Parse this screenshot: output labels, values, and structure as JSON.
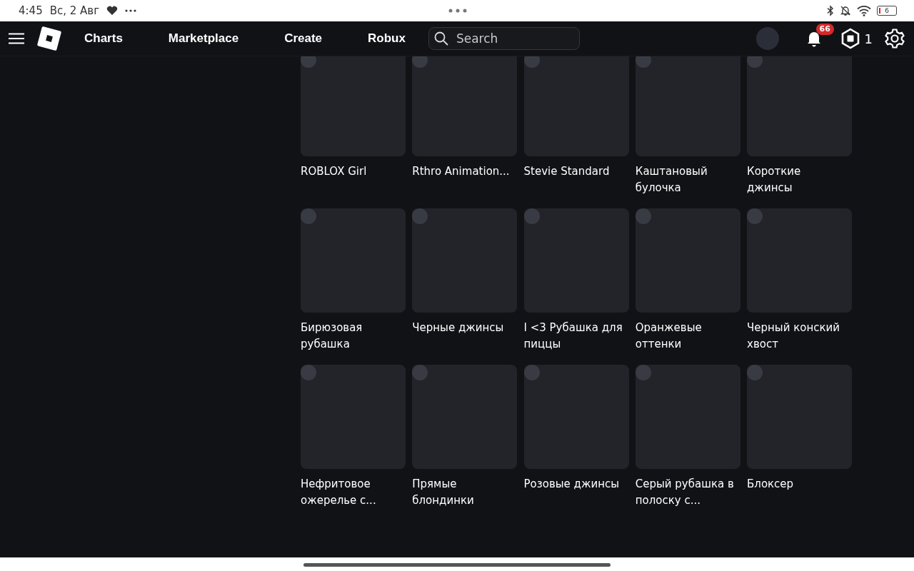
{
  "status_bar": {
    "time": "4:45",
    "date": "Вс, 2 Авг",
    "battery": "6"
  },
  "nav": {
    "links": [
      {
        "label": "Charts"
      },
      {
        "label": "Marketplace"
      },
      {
        "label": "Create"
      },
      {
        "label": "Robux"
      }
    ],
    "search": {
      "placeholder": "Search"
    },
    "notifications": "66",
    "robux": "1"
  },
  "items": [
    {
      "title": "ROBLOX Girl"
    },
    {
      "title": "Rthro Animation..."
    },
    {
      "title": "Stevie Standard"
    },
    {
      "title": "Каштановый булочка"
    },
    {
      "title": "Короткие джинсы"
    },
    {
      "title": "Бирюзовая рубашка"
    },
    {
      "title": "Черные джинсы"
    },
    {
      "title": "I <3 Рубашка для пиццы"
    },
    {
      "title": "Оранжевые оттенки"
    },
    {
      "title": "Черный конский хвост"
    },
    {
      "title": "Нефритовое ожерелье с..."
    },
    {
      "title": "Прямые блондинки"
    },
    {
      "title": "Розовые джинсы"
    },
    {
      "title": "Серый рубашка в полоску с..."
    },
    {
      "title": "Блоксер"
    }
  ]
}
